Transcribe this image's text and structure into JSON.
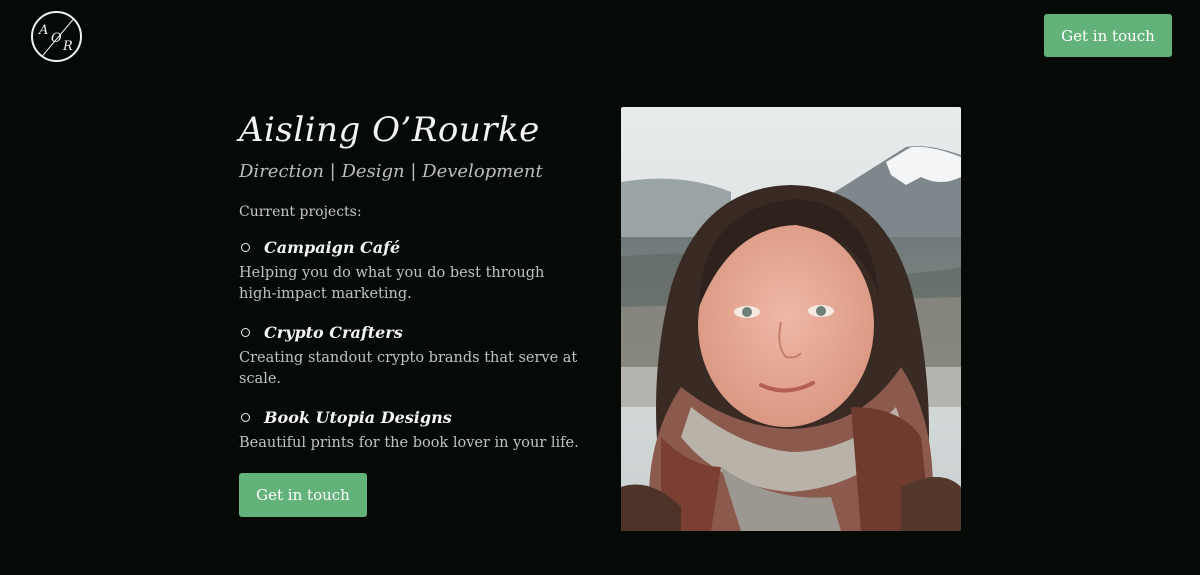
{
  "header": {
    "logo_letters": [
      "A",
      "O",
      "R"
    ],
    "cta_label": "Get in touch"
  },
  "intro": {
    "name": "Aisling O’Rourke",
    "tagline": "Direction | Design | Development",
    "projects_label": "Current projects:",
    "projects": [
      {
        "title": "Campaign Café",
        "description": "Helping you do what you do best through high-impact marketing."
      },
      {
        "title": "Crypto Crafters",
        "description": "Creating standout crypto brands that serve at scale."
      },
      {
        "title": "Book Utopia Designs",
        "description": "Beautiful prints for the book lover in your life."
      }
    ],
    "cta_label": "Get in touch"
  },
  "colors": {
    "background": "#060a07",
    "accent": "#63b27a"
  }
}
